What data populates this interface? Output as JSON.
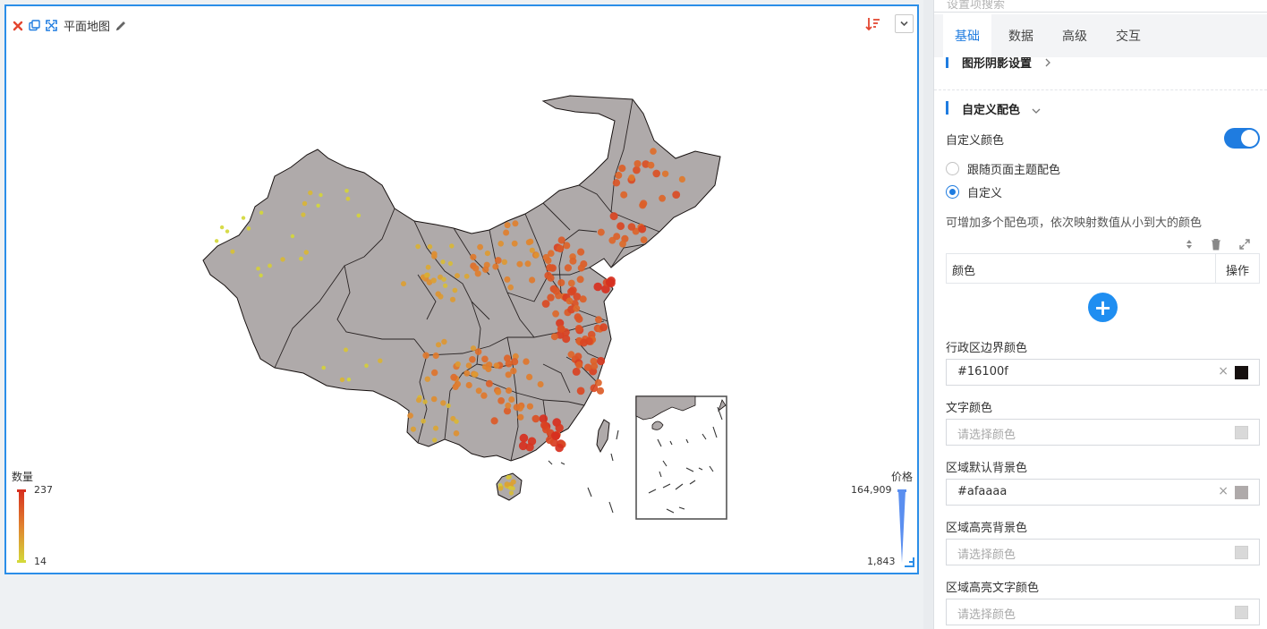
{
  "widget": {
    "title": "平面地图",
    "icons": [
      "close-icon",
      "copy-icon",
      "expand-icon",
      "edit-icon",
      "sort-icon",
      "chevron-down-icon"
    ]
  },
  "legend_color": {
    "title": "数量",
    "max": "237",
    "min": "14",
    "color_top": "#d7301f",
    "color_bottom": "#d4d83a"
  },
  "legend_size": {
    "title": "价格",
    "max": "164,909",
    "min": "1,843",
    "color": "#5b8ff0"
  },
  "map": {
    "region_fill": "#afaaaa",
    "border_color": "#16100f"
  },
  "panel": {
    "search_placeholder": "设置项搜索",
    "tabs": [
      {
        "label": "基础",
        "active": true
      },
      {
        "label": "数据",
        "active": false
      },
      {
        "label": "高级",
        "active": false
      },
      {
        "label": "交互",
        "active": false
      }
    ],
    "shadow_section": "图形阴影设置",
    "color_section": "自定义配色",
    "custom_color_label": "自定义颜色",
    "custom_color_on": true,
    "radio_follow": "跟随页面主题配色",
    "radio_custom": "自定义",
    "hint": "可增加多个配色项，依次映射数值从小到大的颜色",
    "table_col_color": "颜色",
    "table_col_action": "操作",
    "fields": [
      {
        "label": "行政区边界颜色",
        "value": "#16100f",
        "placeholder": "",
        "swatch": "#16100f"
      },
      {
        "label": "文字颜色",
        "value": "",
        "placeholder": "请选择颜色",
        "swatch": ""
      },
      {
        "label": "区域默认背景色",
        "value": "#afaaaa",
        "placeholder": "",
        "swatch": "#afaaaa"
      },
      {
        "label": "区域高亮背景色",
        "value": "",
        "placeholder": "请选择颜色",
        "swatch": ""
      },
      {
        "label": "区域高亮文字颜色",
        "value": "",
        "placeholder": "请选择颜色",
        "swatch": ""
      }
    ]
  }
}
